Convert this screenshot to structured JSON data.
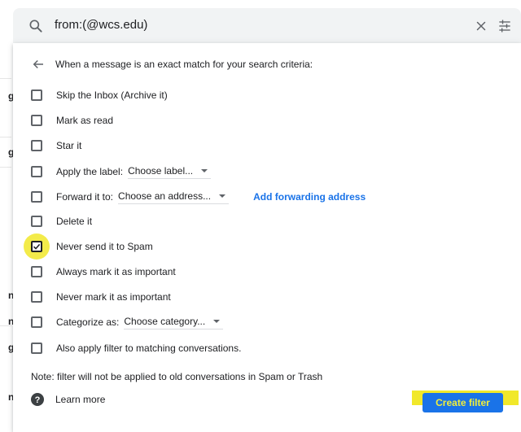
{
  "background": {
    "glyphs": [
      "g",
      "g",
      "n",
      "n",
      "g",
      "n"
    ]
  },
  "search": {
    "query": "from:(@wcs.edu)",
    "icons": {
      "search": "search-icon",
      "clear": "close-icon",
      "options": "tune-icon"
    }
  },
  "dialog": {
    "header": "When a message is an exact match for your search criteria:",
    "options": [
      {
        "label": "Skip the Inbox (Archive it)",
        "checked": false
      },
      {
        "label": "Mark as read",
        "checked": false
      },
      {
        "label": "Star it",
        "checked": false
      },
      {
        "label": "Apply the label:",
        "dropdown": "Choose label...",
        "checked": false
      },
      {
        "label": "Forward it to:",
        "dropdown": "Choose an address...",
        "link": "Add forwarding address",
        "checked": false
      },
      {
        "label": "Delete it",
        "checked": false
      },
      {
        "label": "Never send it to Spam",
        "checked": true
      },
      {
        "label": "Always mark it as important",
        "checked": false
      },
      {
        "label": "Never mark it as important",
        "checked": false
      },
      {
        "label": "Categorize as:",
        "dropdown": "Choose category...",
        "checked": false
      },
      {
        "label": "Also apply filter to matching conversations.",
        "checked": false
      }
    ],
    "note": "Note: filter will not be applied to old conversations in Spam or Trash",
    "learn_more": "Learn more",
    "create_button": "Create filter",
    "colors": {
      "accent": "#1a73e8",
      "highlight": "#f1e82a"
    }
  }
}
